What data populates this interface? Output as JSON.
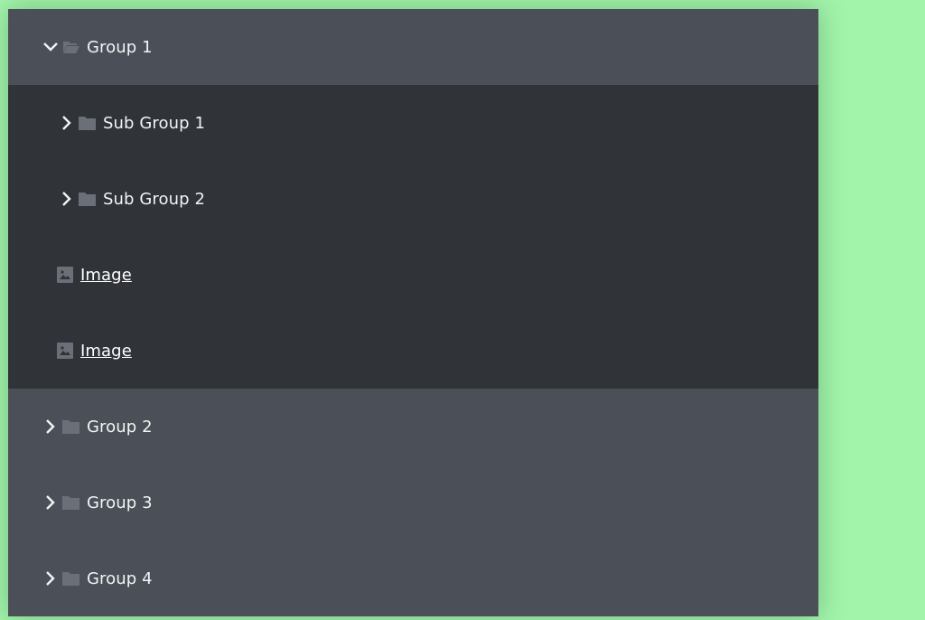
{
  "tree": {
    "groups": [
      {
        "label": "Group 1",
        "expanded": true,
        "children": [
          {
            "type": "folder",
            "label": "Sub Group 1",
            "expanded": false
          },
          {
            "type": "folder",
            "label": "Sub Group 2",
            "expanded": false
          },
          {
            "type": "image-link",
            "label": "Image"
          },
          {
            "type": "image-link",
            "label": "Image"
          }
        ]
      },
      {
        "label": "Group 2",
        "expanded": false
      },
      {
        "label": "Group 3",
        "expanded": false
      },
      {
        "label": "Group 4",
        "expanded": false
      }
    ]
  },
  "icons": {
    "expanded": "chevron-down-icon",
    "collapsed": "chevron-right-icon",
    "folder_open": "folder-open-icon",
    "folder_closed": "folder-icon",
    "image": "image-icon"
  },
  "colors": {
    "background": "#a2f4ab",
    "group_row": "#4b5058",
    "children_bg": "#303338",
    "icon_gray": "#6b6f78",
    "text": "#f2f3f5"
  }
}
